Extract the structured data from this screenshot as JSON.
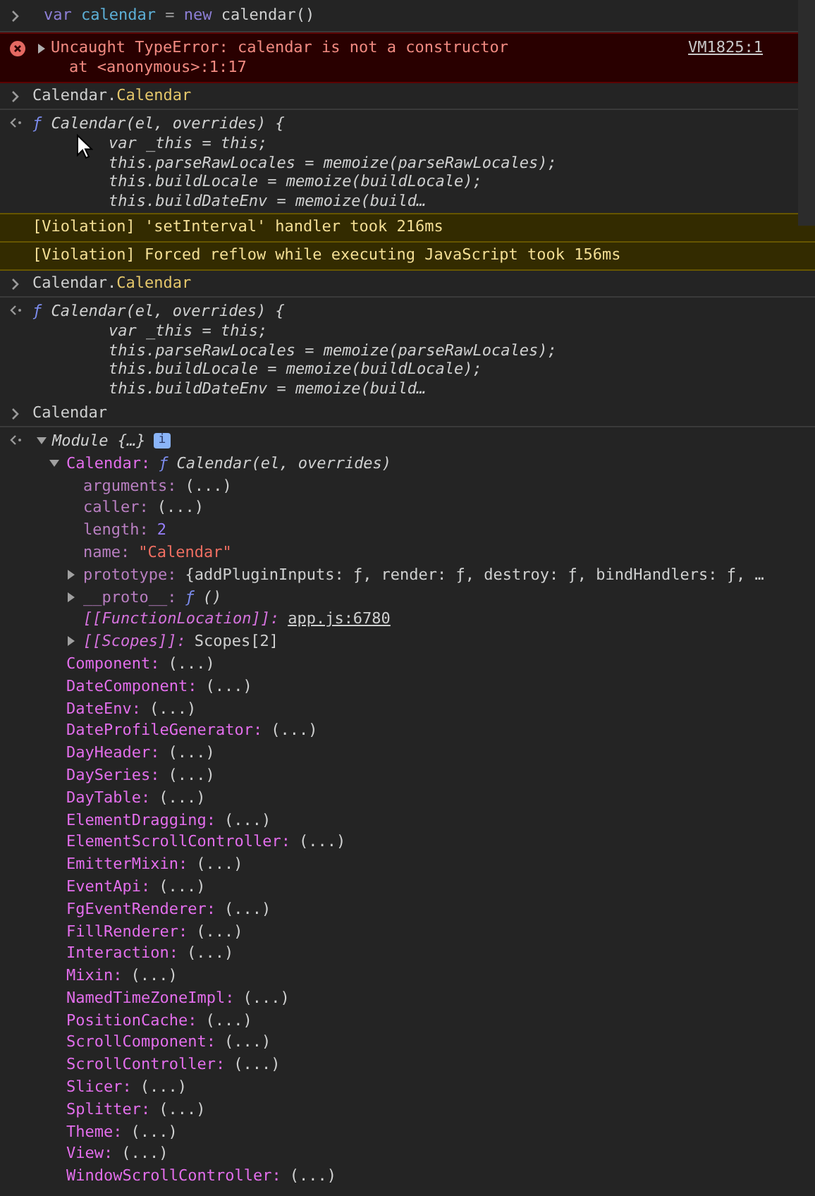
{
  "entries": [
    {
      "kind": "input",
      "tokens": [
        {
          "kind": "keyword",
          "text": "var"
        },
        {
          "kind": "variable",
          "text": " calendar"
        },
        {
          "kind": "operator",
          "text": " = "
        },
        {
          "kind": "keyword",
          "text": "new"
        },
        {
          "kind": "plain",
          "text": " calendar()"
        }
      ]
    },
    {
      "kind": "error",
      "expanded": false,
      "message": "Uncaught TypeError: calendar is not a constructor",
      "detail": "at <anonymous>:1:17",
      "link": "VM1825:1"
    },
    {
      "kind": "input",
      "tokens": [
        {
          "kind": "plain",
          "text": "Calendar."
        },
        {
          "kind": "property",
          "text": "Calendar"
        }
      ]
    },
    {
      "kind": "function",
      "glyph": "ƒ",
      "signature": "Calendar(el, overrides) {",
      "lines": [
        "var _this = this;",
        "this.parseRawLocales = memoize(parseRawLocales);",
        "this.buildLocale = memoize(buildLocale);",
        "this.buildDateEnv = memoize(build…"
      ]
    },
    {
      "kind": "warning",
      "text": "[Violation] 'setInterval' handler took 216ms"
    },
    {
      "kind": "warning",
      "text": "[Violation] Forced reflow while executing JavaScript took 156ms"
    },
    {
      "kind": "input",
      "tokens": [
        {
          "kind": "plain",
          "text": "Calendar."
        },
        {
          "kind": "property",
          "text": "Calendar"
        }
      ]
    },
    {
      "kind": "function",
      "glyph": "ƒ",
      "signature": "Calendar(el, overrides) {",
      "lines": [
        "var _this = this;",
        "this.parseRawLocales = memoize(parseRawLocales);",
        "this.buildLocale = memoize(buildLocale);",
        "this.buildDateEnv = memoize(build…"
      ]
    },
    {
      "kind": "input",
      "tokens": [
        {
          "kind": "plain",
          "text": "Calendar"
        }
      ]
    },
    {
      "kind": "tree",
      "root": {
        "summary": "Module {…}",
        "badge": "i",
        "expanded": true,
        "children": [
          {
            "key": {
              "kind": "own",
              "text": "Calendar:"
            },
            "value": {
              "kind": "function",
              "glyph": "ƒ",
              "text": "Calendar(el, overrides)"
            },
            "expanded": true,
            "children": [
              {
                "key": {
                  "kind": "hidden",
                  "text": "arguments:"
                },
                "value": {
                  "kind": "plain",
                  "text": "(...)"
                }
              },
              {
                "key": {
                  "kind": "hidden",
                  "text": "caller:"
                },
                "value": {
                  "kind": "plain",
                  "text": "(...)"
                }
              },
              {
                "key": {
                  "kind": "hidden",
                  "text": "length:"
                },
                "value": {
                  "kind": "number",
                  "text": "2"
                }
              },
              {
                "key": {
                  "kind": "hidden",
                  "text": "name:"
                },
                "value": {
                  "kind": "string",
                  "text": "\"Calendar\""
                }
              },
              {
                "key": {
                  "kind": "hidden",
                  "text": "prototype:"
                },
                "value": {
                  "kind": "plain",
                  "text": "{addPluginInputs: ƒ, render: ƒ, destroy: ƒ, bindHandlers: ƒ, …"
                },
                "expanded": false
              },
              {
                "key": {
                  "kind": "hidden",
                  "text": "__proto__:"
                },
                "value": {
                  "kind": "function",
                  "glyph": "ƒ",
                  "text": "()"
                },
                "expanded": false
              },
              {
                "key": {
                  "kind": "internal",
                  "text": "[[FunctionLocation]]:"
                },
                "value": {
                  "kind": "link",
                  "text": "app.js:6780"
                }
              },
              {
                "key": {
                  "kind": "internal",
                  "text": "[[Scopes]]:"
                },
                "value": {
                  "kind": "plain",
                  "text": "Scopes[2]"
                },
                "expanded": false
              }
            ]
          },
          {
            "key": {
              "kind": "own",
              "text": "Component:"
            },
            "value": {
              "kind": "plain",
              "text": "(...)"
            }
          },
          {
            "key": {
              "kind": "own",
              "text": "DateComponent:"
            },
            "value": {
              "kind": "plain",
              "text": "(...)"
            }
          },
          {
            "key": {
              "kind": "own",
              "text": "DateEnv:"
            },
            "value": {
              "kind": "plain",
              "text": "(...)"
            }
          },
          {
            "key": {
              "kind": "own",
              "text": "DateProfileGenerator:"
            },
            "value": {
              "kind": "plain",
              "text": "(...)"
            }
          },
          {
            "key": {
              "kind": "own",
              "text": "DayHeader:"
            },
            "value": {
              "kind": "plain",
              "text": "(...)"
            }
          },
          {
            "key": {
              "kind": "own",
              "text": "DaySeries:"
            },
            "value": {
              "kind": "plain",
              "text": "(...)"
            }
          },
          {
            "key": {
              "kind": "own",
              "text": "DayTable:"
            },
            "value": {
              "kind": "plain",
              "text": "(...)"
            }
          },
          {
            "key": {
              "kind": "own",
              "text": "ElementDragging:"
            },
            "value": {
              "kind": "plain",
              "text": "(...)"
            }
          },
          {
            "key": {
              "kind": "own",
              "text": "ElementScrollController:"
            },
            "value": {
              "kind": "plain",
              "text": "(...)"
            }
          },
          {
            "key": {
              "kind": "own",
              "text": "EmitterMixin:"
            },
            "value": {
              "kind": "plain",
              "text": "(...)"
            }
          },
          {
            "key": {
              "kind": "own",
              "text": "EventApi:"
            },
            "value": {
              "kind": "plain",
              "text": "(...)"
            }
          },
          {
            "key": {
              "kind": "own",
              "text": "FgEventRenderer:"
            },
            "value": {
              "kind": "plain",
              "text": "(...)"
            }
          },
          {
            "key": {
              "kind": "own",
              "text": "FillRenderer:"
            },
            "value": {
              "kind": "plain",
              "text": "(...)"
            }
          },
          {
            "key": {
              "kind": "own",
              "text": "Interaction:"
            },
            "value": {
              "kind": "plain",
              "text": "(...)"
            }
          },
          {
            "key": {
              "kind": "own",
              "text": "Mixin:"
            },
            "value": {
              "kind": "plain",
              "text": "(...)"
            }
          },
          {
            "key": {
              "kind": "own",
              "text": "NamedTimeZoneImpl:"
            },
            "value": {
              "kind": "plain",
              "text": "(...)"
            }
          },
          {
            "key": {
              "kind": "own",
              "text": "PositionCache:"
            },
            "value": {
              "kind": "plain",
              "text": "(...)"
            }
          },
          {
            "key": {
              "kind": "own",
              "text": "ScrollComponent:"
            },
            "value": {
              "kind": "plain",
              "text": "(...)"
            }
          },
          {
            "key": {
              "kind": "own",
              "text": "ScrollController:"
            },
            "value": {
              "kind": "plain",
              "text": "(...)"
            }
          },
          {
            "key": {
              "kind": "own",
              "text": "Slicer:"
            },
            "value": {
              "kind": "plain",
              "text": "(...)"
            }
          },
          {
            "key": {
              "kind": "own",
              "text": "Splitter:"
            },
            "value": {
              "kind": "plain",
              "text": "(...)"
            }
          },
          {
            "key": {
              "kind": "own",
              "text": "Theme:"
            },
            "value": {
              "kind": "plain",
              "text": "(...)"
            }
          },
          {
            "key": {
              "kind": "own",
              "text": "View:"
            },
            "value": {
              "kind": "plain",
              "text": "(...)"
            }
          },
          {
            "key": {
              "kind": "own",
              "text": "WindowScrollController:"
            },
            "value": {
              "kind": "plain",
              "text": "(...)"
            }
          }
        ]
      }
    }
  ]
}
